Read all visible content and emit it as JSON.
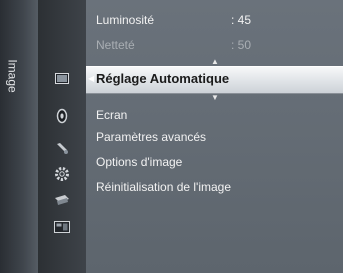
{
  "side_tab": {
    "label": "Image"
  },
  "sidebar_icons": [
    "picture-icon",
    "sound-icon",
    "channel-icon",
    "setup-icon",
    "input-icon",
    "application-icon"
  ],
  "adjust_rows": [
    {
      "label": "Luminosité",
      "value": ": 45"
    },
    {
      "label": "Netteté",
      "value": ": 50"
    }
  ],
  "selected_item": {
    "label": "Réglage Automatique"
  },
  "menu_items": [
    {
      "label": "Ecran"
    },
    {
      "label": "Paramètres avancés"
    },
    {
      "label": "Options d'image"
    },
    {
      "label": "Réinitialisation de l'image"
    }
  ],
  "colors": {
    "highlight_bar": "#eef0f2",
    "panel_bg": "#646b74",
    "text": "#f2f2f2"
  }
}
